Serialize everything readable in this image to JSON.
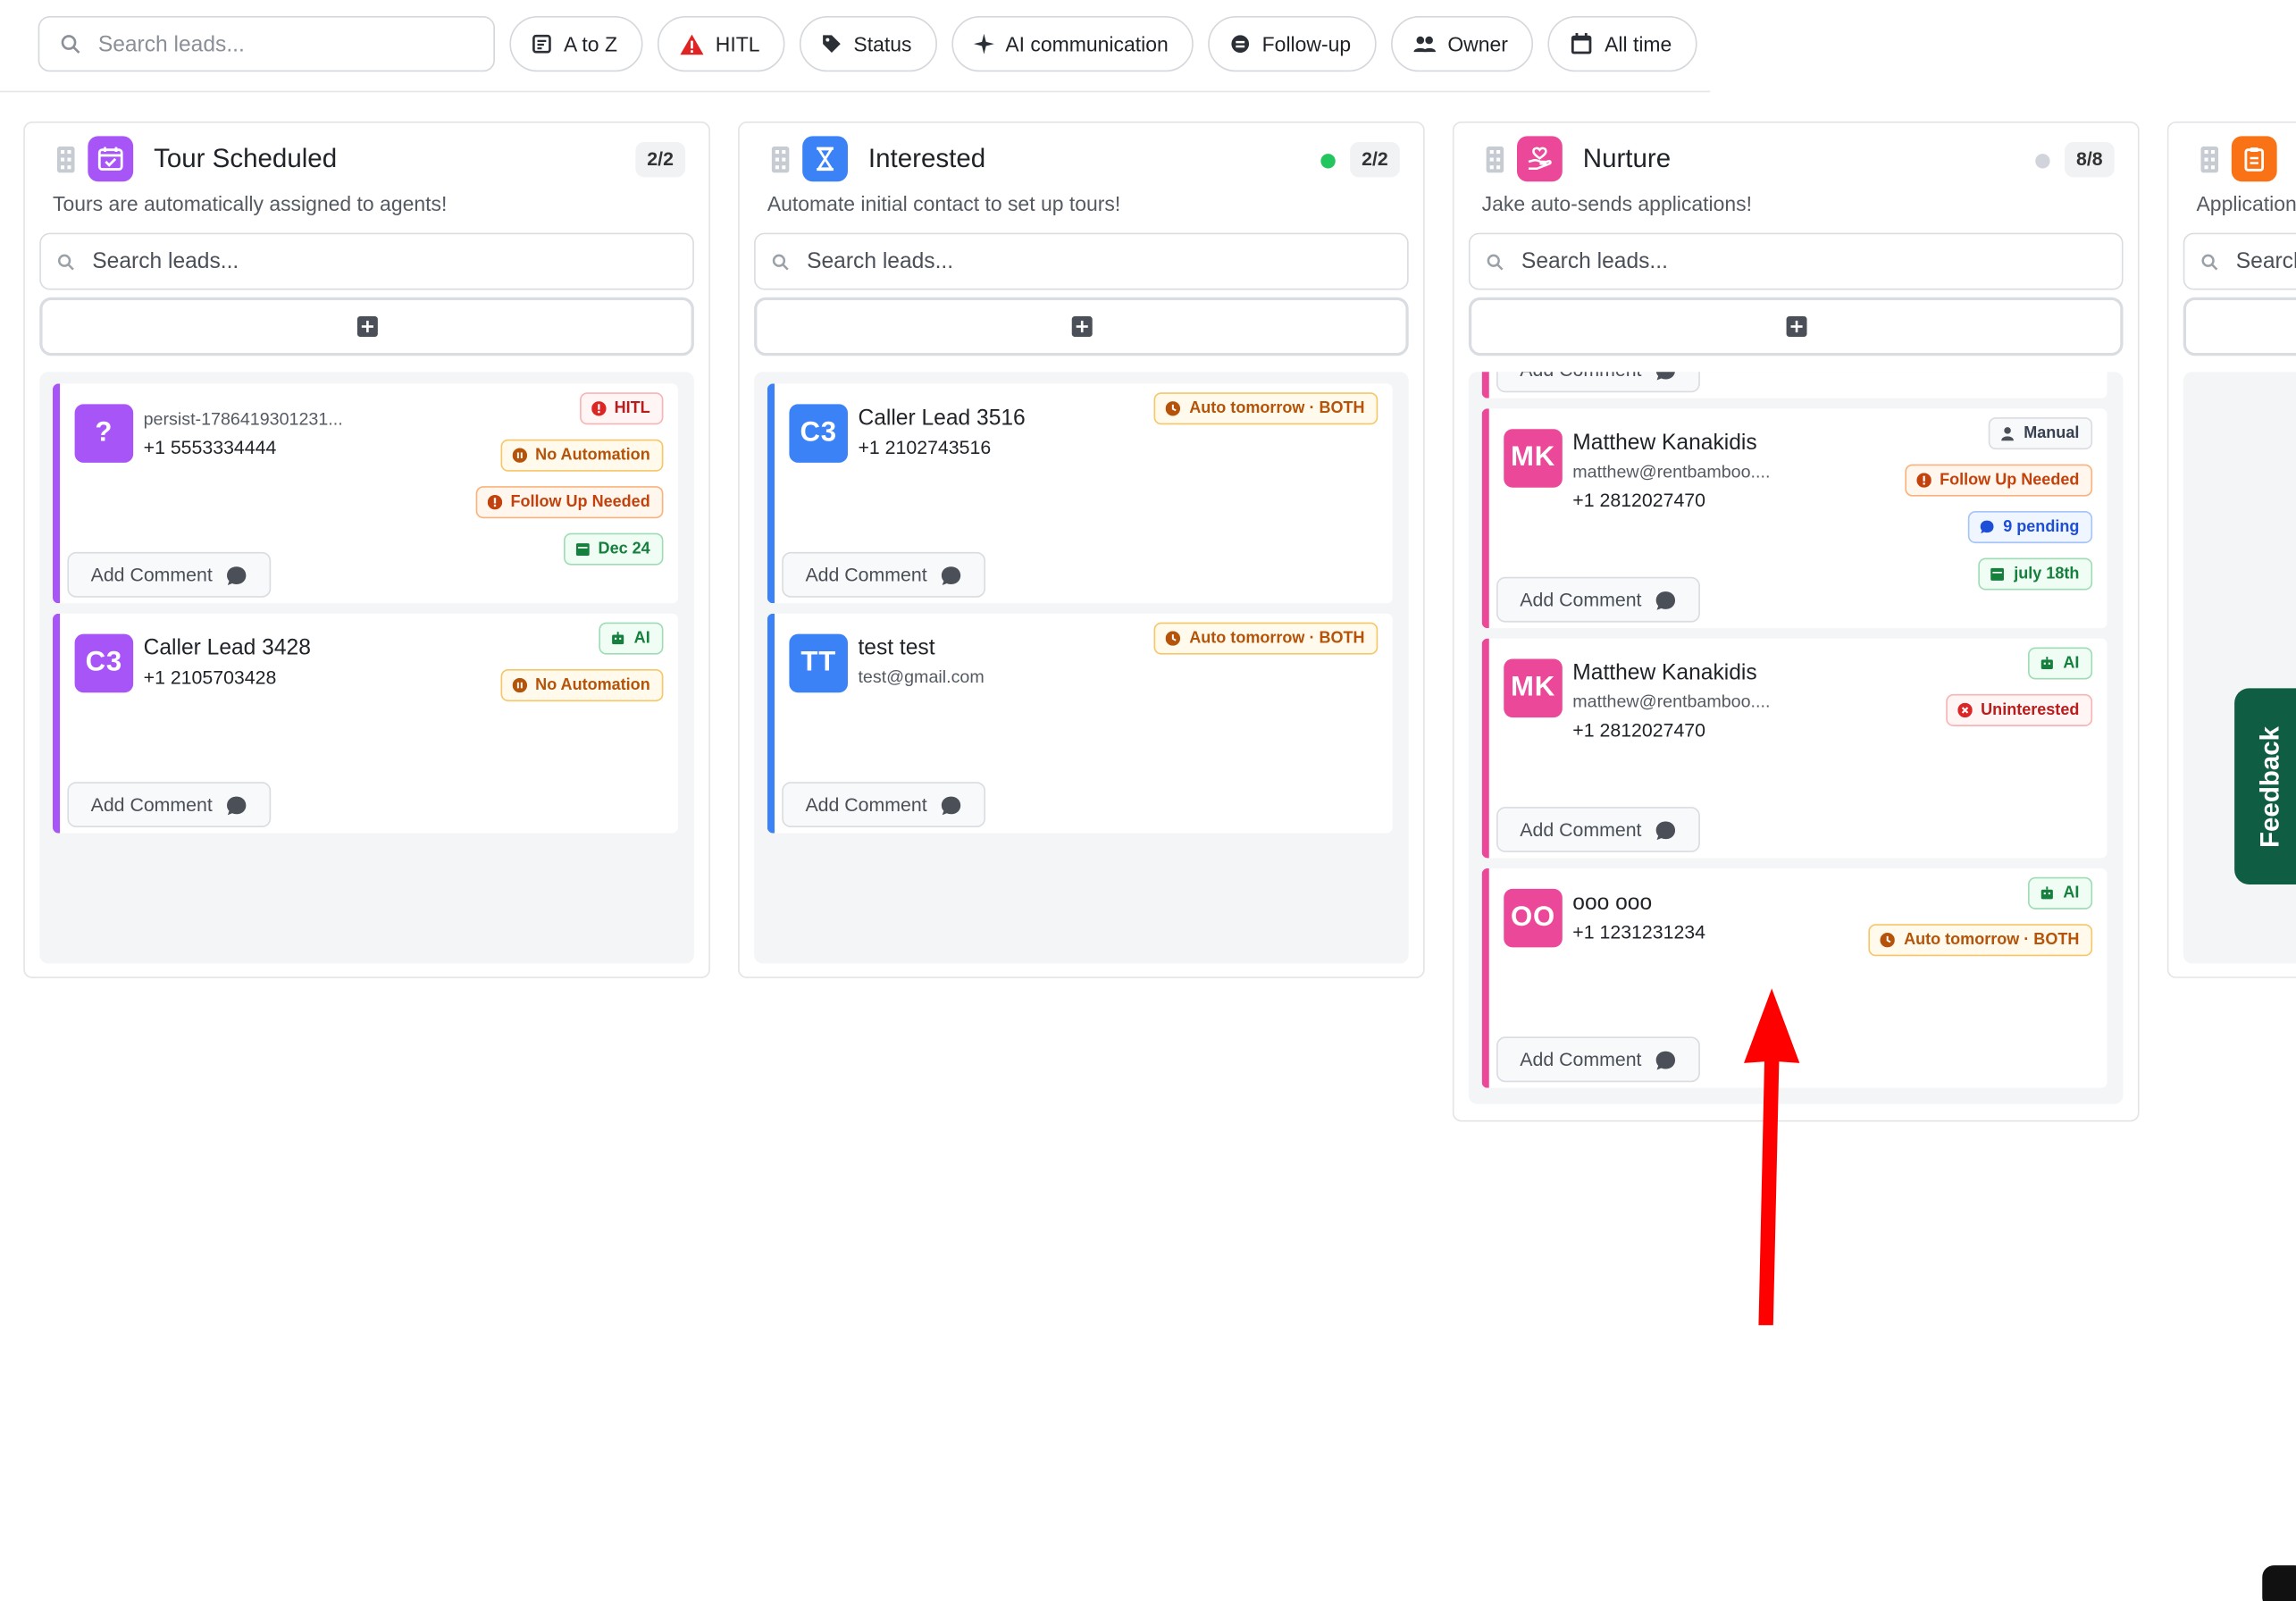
{
  "toolbar": {
    "search_placeholder": "Search leads...",
    "filters": [
      {
        "label": "A to Z",
        "icon": "sort-icon"
      },
      {
        "label": "HITL",
        "icon": "warning-icon"
      },
      {
        "label": "Status",
        "icon": "tag-icon"
      },
      {
        "label": "AI communication",
        "icon": "sparkle-icon"
      },
      {
        "label": "Follow-up",
        "icon": "followup-icon"
      },
      {
        "label": "Owner",
        "icon": "users-icon"
      },
      {
        "label": "All time",
        "icon": "calendar-icon"
      }
    ]
  },
  "columns": [
    {
      "title": "Tour Scheduled",
      "count": "2/2",
      "description": "Tours are automatically assigned to agents!",
      "search_placeholder": "Search leads...",
      "accent": "#a855f7",
      "icon": "calendar-check-icon",
      "cards": [
        {
          "initials": "?",
          "name": "persist-1786419301231...",
          "phone": "+1 5553334444",
          "badges": [
            "HITL",
            "No Automation",
            "Follow Up Needed",
            "Dec 24"
          ],
          "comment": "Add Comment"
        },
        {
          "initials": "C3",
          "name": "Caller Lead 3428",
          "phone": "+1 2105703428",
          "badges": [
            "AI",
            "No Automation"
          ],
          "comment": "Add Comment"
        }
      ]
    },
    {
      "title": "Interested",
      "count": "2/2",
      "status_dot": "#22c55e",
      "description": "Automate initial contact to set up tours!",
      "search_placeholder": "Search leads...",
      "accent": "#3b82f6",
      "icon": "hourglass-icon",
      "cards": [
        {
          "initials": "C3",
          "name": "Caller Lead 3516",
          "phone": "+1 2102743516",
          "badges": [
            "Auto tomorrow · BOTH"
          ],
          "comment": "Add Comment"
        },
        {
          "initials": "TT",
          "name": "test test",
          "email": "test@gmail.com",
          "badges": [
            "Auto tomorrow · BOTH"
          ],
          "comment": "Add Comment"
        }
      ]
    },
    {
      "title": "Nurture",
      "count": "8/8",
      "status_dot": "#d1d5db",
      "description": "Jake auto-sends applications!",
      "search_placeholder": "Search leads...",
      "accent": "#ec4899",
      "icon": "hand-heart-icon",
      "partial_comment": "Add Comment",
      "cards": [
        {
          "initials": "MK",
          "name": "Matthew Kanakidis",
          "email": "matthew@rentbamboo....",
          "phone": "+1 2812027470",
          "badges": [
            "Manual",
            "Follow Up Needed",
            "9 pending",
            "july 18th"
          ],
          "comment": "Add Comment"
        },
        {
          "initials": "MK",
          "name": "Matthew Kanakidis",
          "email": "matthew@rentbamboo....",
          "phone": "+1 2812027470",
          "badges": [
            "AI",
            "Uninterested"
          ],
          "comment": "Add Comment"
        },
        {
          "initials": "OO",
          "name": "ooo ooo",
          "phone": "+1 1231231234",
          "badges": [
            "AI",
            "Auto tomorrow · BOTH"
          ],
          "comment": "Add Comment"
        }
      ]
    },
    {
      "title": "",
      "description": "Application",
      "search_placeholder": "Search",
      "accent": "#f97316",
      "icon": "clipboard-icon"
    }
  ],
  "feedback_label": "Feedback",
  "colors": {
    "annotation_arrow": "#ff0000",
    "feedback_bg": "#0f5d43"
  }
}
